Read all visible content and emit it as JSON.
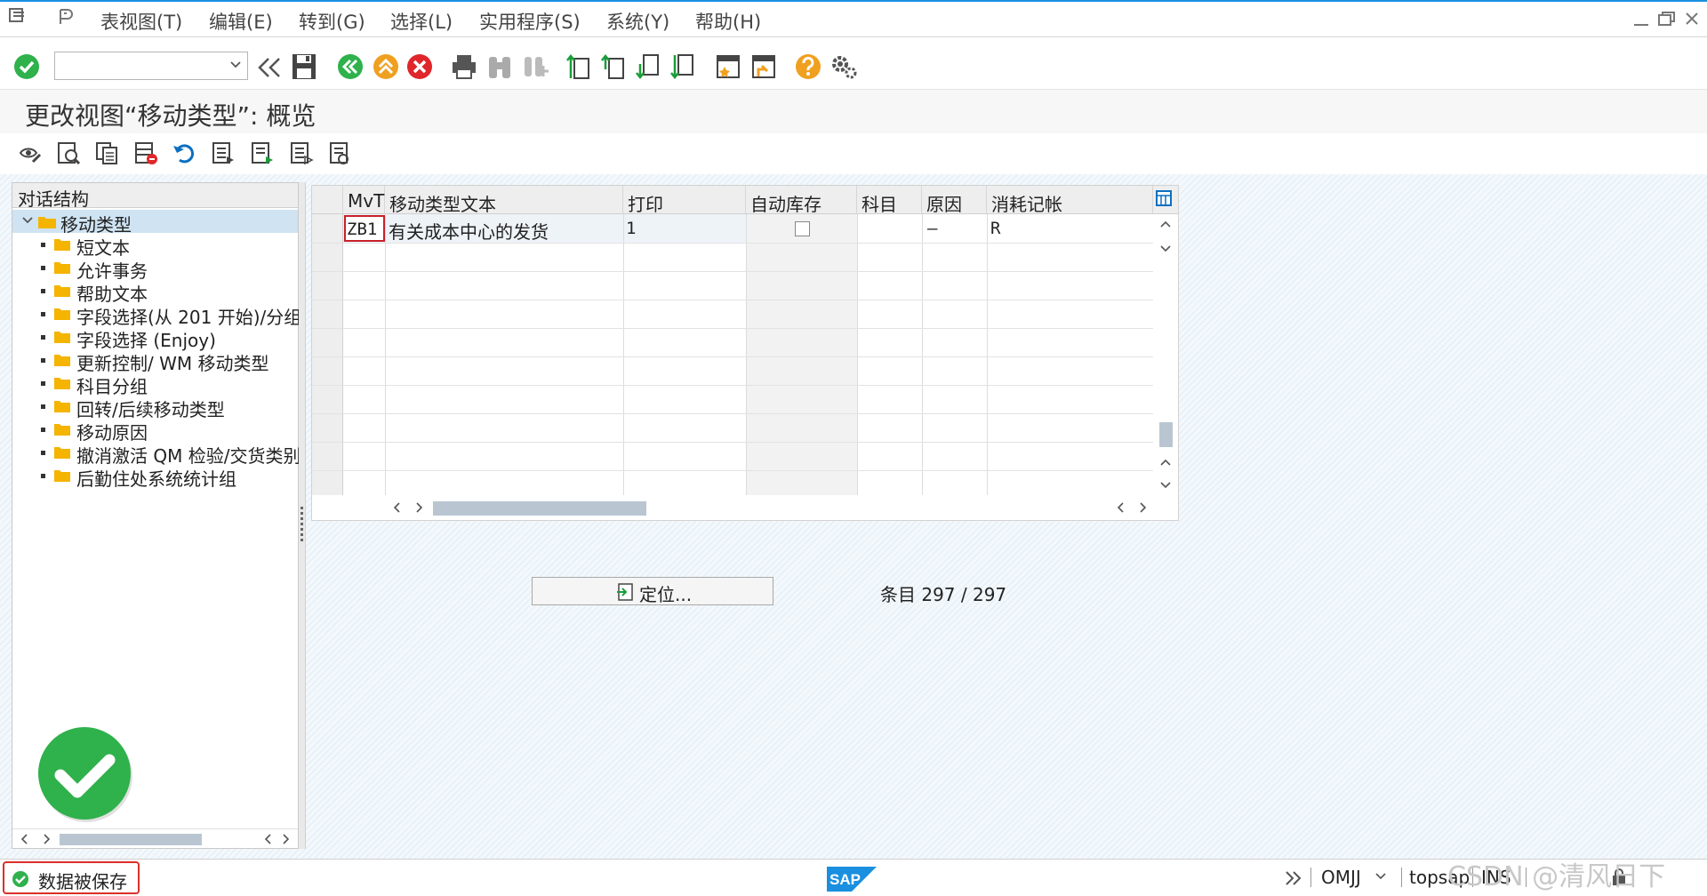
{
  "menu": {
    "items": [
      "表视图(T)",
      "编辑(E)",
      "转到(G)",
      "选择(L)",
      "实用程序(S)",
      "系统(Y)",
      "帮助(H)"
    ]
  },
  "toolbar": {
    "command_field_value": ""
  },
  "title": "更改视图“移动类型”: 概览",
  "tree": {
    "header": "对话结构",
    "root": "移动类型",
    "items": [
      "短文本",
      "允许事务",
      "帮助文本",
      "字段选择(从 201 开始)/分组",
      "字段选择 (Enjoy)",
      "更新控制/ WM 移动类型",
      "科目分组",
      "回转/后续移动类型",
      "移动原因",
      "撤消激活 QM 检验/交货类别",
      "后勤住处系统统计组"
    ]
  },
  "table": {
    "columns": [
      "MvT",
      "移动类型文本",
      "打印",
      "自动库存",
      "科目",
      "原因",
      "消耗记帐"
    ],
    "rows": [
      {
        "mvt": "ZB1",
        "text": "有关成本中心的发货",
        "print": "1",
        "auto_stock": false,
        "account": "",
        "reason": "–",
        "consumption": "R"
      }
    ]
  },
  "buttons": {
    "position": "定位..."
  },
  "entry_info": "条目 297 / 297",
  "status": {
    "message": "数据被保存",
    "transaction": "OMJJ",
    "server": "topsap",
    "mode": "INS"
  },
  "watermark": "CSDN @清风日下",
  "colors": {
    "accent_blue": "#1a8fe0",
    "success_green": "#2fb14b",
    "cancel_red": "#e0262a",
    "warning_orange": "#f0a020",
    "folder_yellow": "#f5b400",
    "error_border": "#d9302a"
  },
  "icons": {
    "menu": "menu-icon",
    "ok": "checkmark-icon",
    "save": "save-icon",
    "back": "back-icon",
    "exit": "exit-icon",
    "cancel": "cancel-icon",
    "help": "help-icon",
    "settings": "gear-icon",
    "position": "position-icon",
    "success": "success-icon"
  }
}
